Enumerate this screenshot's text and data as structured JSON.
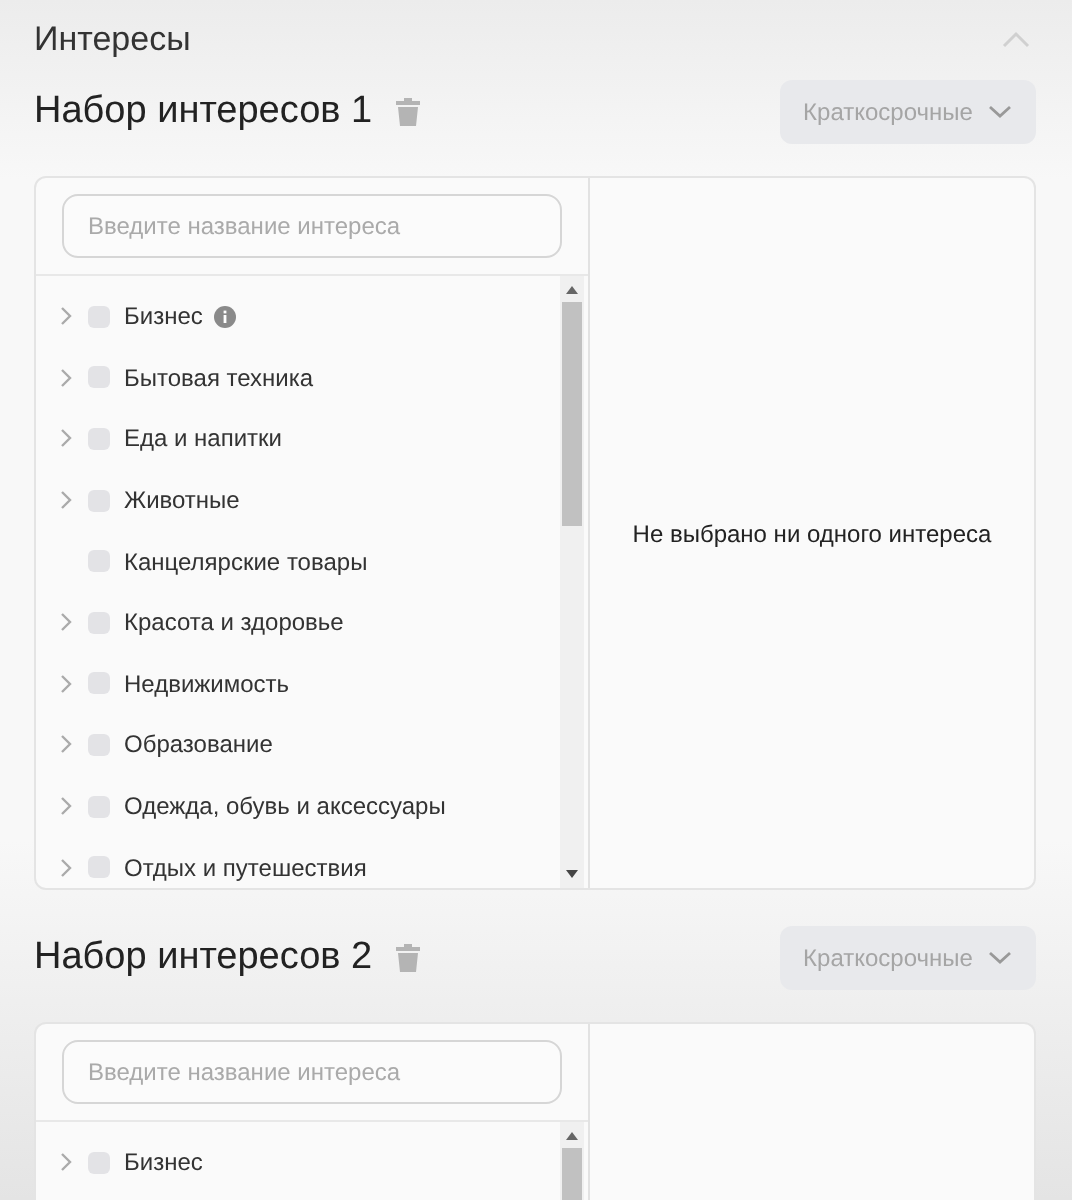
{
  "section": {
    "title": "Интересы",
    "expanded": true
  },
  "sets": [
    {
      "title": "Набор интересов 1",
      "term": "Краткосрочные",
      "search": {
        "placeholder": "Введите название интереса"
      },
      "empty_text": "Не выбрано ни одного интереса",
      "items": [
        {
          "label": "Бизнес",
          "has_children": true,
          "checked": false,
          "info": true
        },
        {
          "label": "Бытовая техника",
          "has_children": true,
          "checked": false,
          "info": false
        },
        {
          "label": "Еда и напитки",
          "has_children": true,
          "checked": false,
          "info": false
        },
        {
          "label": "Животные",
          "has_children": true,
          "checked": false,
          "info": false
        },
        {
          "label": "Канцелярские товары",
          "has_children": false,
          "checked": false,
          "info": false
        },
        {
          "label": "Красота и здоровье",
          "has_children": true,
          "checked": false,
          "info": false
        },
        {
          "label": "Недвижимость",
          "has_children": true,
          "checked": false,
          "info": false
        },
        {
          "label": "Образование",
          "has_children": true,
          "checked": false,
          "info": false
        },
        {
          "label": "Одежда, обувь и аксессуары",
          "has_children": true,
          "checked": false,
          "info": false
        },
        {
          "label": "Отдых и путешествия",
          "has_children": true,
          "checked": false,
          "info": false
        }
      ]
    },
    {
      "title": "Набор интересов 2",
      "term": "Краткосрочные",
      "search": {
        "placeholder": "Введите название интереса"
      },
      "items": [
        {
          "label": "Бизнес",
          "has_children": true,
          "checked": false,
          "info": false
        }
      ]
    }
  ]
}
